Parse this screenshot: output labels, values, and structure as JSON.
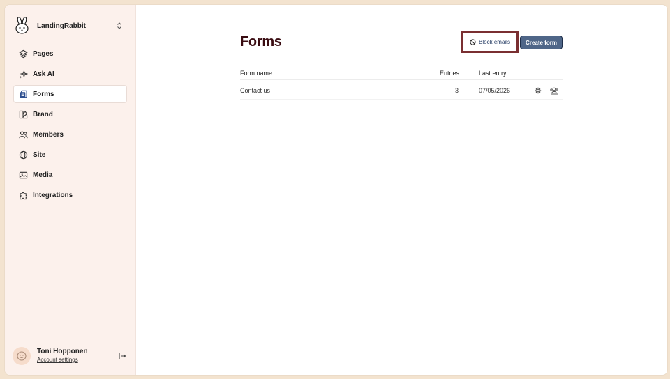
{
  "brand": {
    "name": "LandingRabbit",
    "logo_icon": "rabbit-logo-icon"
  },
  "nav": {
    "items": [
      {
        "label": "Pages",
        "icon": "layers-icon",
        "active": false
      },
      {
        "label": "Ask AI",
        "icon": "sparkles-icon",
        "active": false
      },
      {
        "label": "Forms",
        "icon": "forms-icon",
        "active": true
      },
      {
        "label": "Brand",
        "icon": "palette-icon",
        "active": false
      },
      {
        "label": "Members",
        "icon": "users-icon",
        "active": false
      },
      {
        "label": "Site",
        "icon": "globe-icon",
        "active": false
      },
      {
        "label": "Media",
        "icon": "image-icon",
        "active": false
      },
      {
        "label": "Integrations",
        "icon": "puzzle-icon",
        "active": false
      }
    ]
  },
  "user": {
    "name": "Toni Hopponen",
    "account_link": "Account settings"
  },
  "page": {
    "title": "Forms"
  },
  "actions": {
    "block_emails": "Block emails",
    "create_form": "Create form"
  },
  "table": {
    "headers": {
      "name": "Form name",
      "entries": "Entries",
      "last_entry": "Last entry"
    },
    "rows": [
      {
        "name": "Contact us",
        "entries": "3",
        "last_entry": "07/05/2026"
      }
    ]
  },
  "colors": {
    "accent": "#4f6688",
    "title": "#3a0c12",
    "highlight_border": "#7a2f31",
    "sidebar_bg": "#fcf1ec"
  }
}
